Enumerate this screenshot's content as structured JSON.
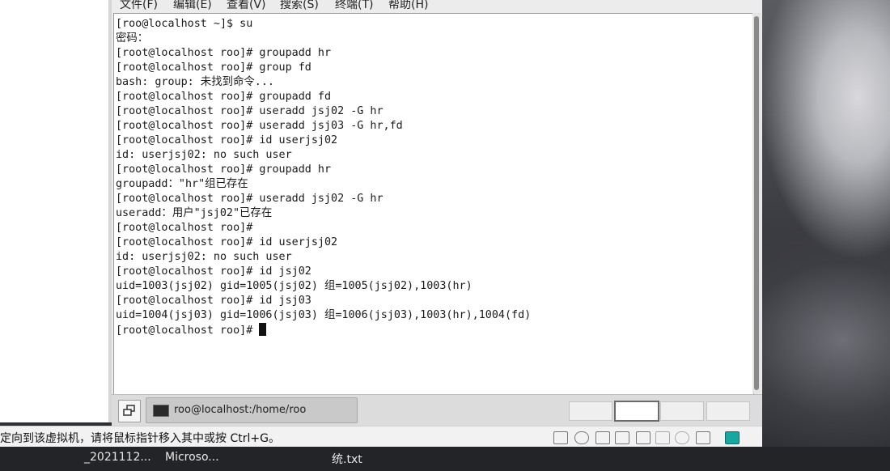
{
  "menu": [
    "文件(F)",
    "编辑(E)",
    "查看(V)",
    "搜索(S)",
    "终端(T)",
    "帮助(H)"
  ],
  "terminal": {
    "lines": [
      "[roo@localhost ~]$ su",
      "密码：",
      "[root@localhost roo]# groupadd hr",
      "[root@localhost roo]# group fd",
      "bash: group: 未找到命令...",
      "[root@localhost roo]# groupadd fd",
      "[root@localhost roo]# useradd jsj02 -G hr",
      "[root@localhost roo]# useradd jsj03 -G hr,fd",
      "[root@localhost roo]# id userjsj02",
      "id: userjsj02: no such user",
      "[root@localhost roo]# groupadd hr",
      "groupadd：\"hr\"组已存在",
      "[root@localhost roo]# useradd jsj02 -G hr",
      "useradd：用户\"jsj02\"已存在",
      "[root@localhost roo]#",
      "[root@localhost roo]# id userjsj02",
      "id: userjsj02: no such user",
      "[root@localhost roo]# id jsj02",
      "uid=1003(jsj02) gid=1005(jsj02) 组=1005(jsj02),1003(hr)",
      "[root@localhost roo]# id jsj03",
      "uid=1004(jsj03) gid=1006(jsj03) 组=1006(jsj03),1003(hr),1004(fd)"
    ],
    "prompt": "[root@localhost roo]# "
  },
  "taskbar": {
    "task_label": "roo@localhost:/home/roo"
  },
  "status": {
    "message": "定向到该虚拟机，请将鼠标指针移入其中或按 Ctrl+G。"
  },
  "host_taskbar": {
    "items": [
      "_2021112...",
      "Microso...",
      "统.txt"
    ]
  },
  "colors": {
    "terminal_bg": "#ffffff",
    "text": "#1a1a1a",
    "status_icon_accent": "#1aa6a0"
  }
}
